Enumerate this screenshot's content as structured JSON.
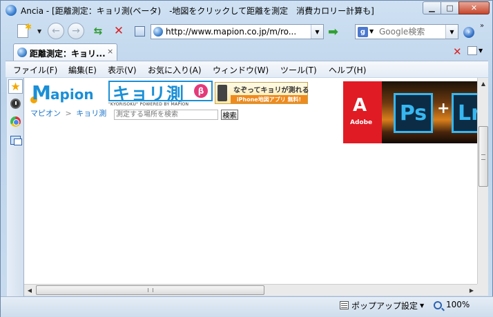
{
  "window": {
    "title": "Ancia - [距離測定：キョリ測(ベータ)　-地図をクリックして距離を測定　消費カロリー計算も]",
    "controls": {
      "minimize": "▁",
      "maximize": "□",
      "close": "✕"
    }
  },
  "navbar": {
    "url": "http://www.mapion.co.jp/m/ro...",
    "search_placeholder": "Google検索",
    "search_engine_letter": "g",
    "overflow": "»"
  },
  "tabs": [
    {
      "label": "距離測定：キョリ...",
      "close": "×"
    }
  ],
  "menu": {
    "items": [
      "ファイル(F)",
      "編集(E)",
      "表示(V)",
      "お気に入り(A)",
      "ウィンドウ(W)",
      "ツール(T)",
      "ヘルプ(H)"
    ]
  },
  "page": {
    "mapion_first": "M",
    "mapion_rest": "apion",
    "kyori_logo": "キョリ測",
    "kyori_beta": "β",
    "kyori_sub": "\"KYORISOKU\" POWERED BY MAPION",
    "breadcrumbs": [
      "マピオン",
      "キョリ測"
    ],
    "breadcrumb_sep": ">",
    "place_search_placeholder": "測定する場所を検索",
    "place_search_button": "検索",
    "banner_line1": "なぞってキョリが測れる",
    "banner_line2": "iPhone地図アプリ 無料!",
    "ad": {
      "adobe_label": "Adobe",
      "ps": "Ps",
      "plus": "+",
      "lr": "Lr"
    }
  },
  "status": {
    "popup_label": "ポップアップ設定",
    "zoom": "100%"
  },
  "colors": {
    "mapion_blue": "#1a8fd6",
    "beta_pink": "#e43a7a",
    "adobe_red": "#e01b24"
  }
}
